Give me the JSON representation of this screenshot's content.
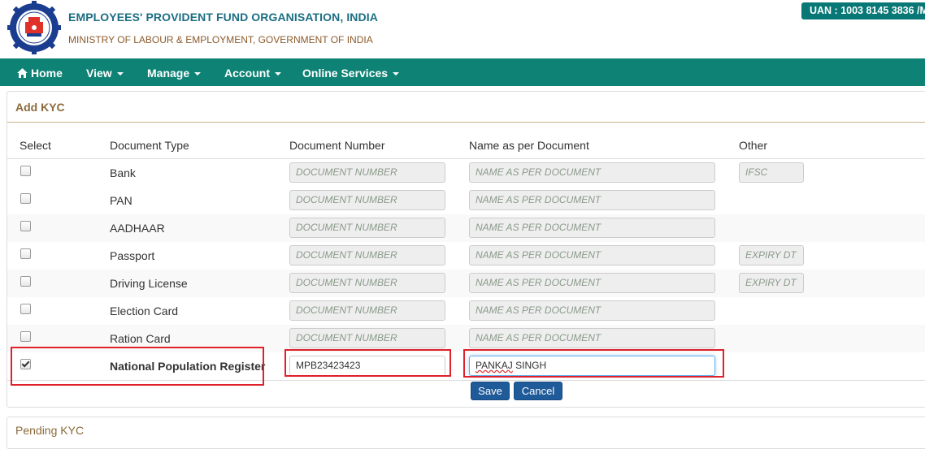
{
  "header": {
    "org_title": "EMPLOYEES' PROVIDENT FUND ORGANISATION, INDIA",
    "ministry": "MINISTRY OF LABOUR & EMPLOYMENT, GOVERNMENT OF INDIA",
    "uan": "UAN : 1003 8145 3836 /M"
  },
  "nav": {
    "home": "Home",
    "view": "View",
    "manage": "Manage",
    "account": "Account",
    "online_services": "Online Services"
  },
  "kyc": {
    "title": "Add KYC",
    "columns": [
      "Select",
      "Document Type",
      "Document Number",
      "Name as per Document",
      "Other"
    ],
    "placeholders": {
      "doc_number": "DOCUMENT NUMBER",
      "name": "NAME AS PER DOCUMENT"
    },
    "rows": [
      {
        "type": "Bank",
        "checked": false,
        "doc_number": "",
        "name": "",
        "other": "IFSC"
      },
      {
        "type": "PAN",
        "checked": false,
        "doc_number": "",
        "name": "",
        "other": null
      },
      {
        "type": "AADHAAR",
        "checked": false,
        "doc_number": "",
        "name": "",
        "other": null
      },
      {
        "type": "Passport",
        "checked": false,
        "doc_number": "",
        "name": "",
        "other": "EXPIRY DT"
      },
      {
        "type": "Driving License",
        "checked": false,
        "doc_number": "",
        "name": "",
        "other": "EXPIRY DT"
      },
      {
        "type": "Election Card",
        "checked": false,
        "doc_number": "",
        "name": "",
        "other": null
      },
      {
        "type": "Ration Card",
        "checked": false,
        "doc_number": "",
        "name": "",
        "other": null
      },
      {
        "type": "National Population Register",
        "checked": true,
        "doc_number": "MPB23423423",
        "name_part1": "PANKAJ",
        "name_part2": " SINGH",
        "other": null
      }
    ],
    "save_label": "Save",
    "cancel_label": "Cancel"
  },
  "pending": {
    "title": "Pending KYC"
  },
  "colors": {
    "nav_bg": "#0e8275",
    "title_blue": "#1b6e83",
    "button_blue": "#1f5a99",
    "highlight_red": "#e0202a"
  }
}
